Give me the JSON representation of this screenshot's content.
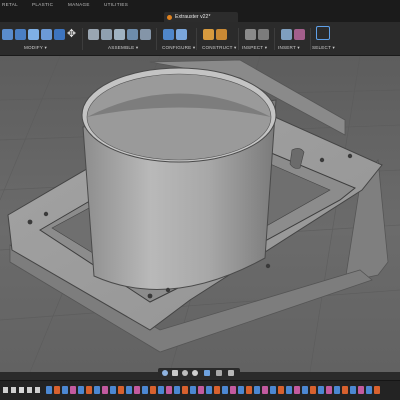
{
  "window": {
    "document_title": "Extrauster v22*"
  },
  "menu_tabs": [
    {
      "label": "RETAL"
    },
    {
      "label": "PLASTIC"
    },
    {
      "label": "MANAGE"
    },
    {
      "label": "UTILITIES"
    }
  ],
  "ribbon": {
    "groups": [
      {
        "label": "MODIFY ▾"
      },
      {
        "label": "ASSEMBLE ▾"
      },
      {
        "label": "CONFIGURE ▾"
      },
      {
        "label": "CONSTRUCT ▾"
      },
      {
        "label": "INSPECT ▾"
      },
      {
        "label": "INSERT ▾"
      },
      {
        "label": "SELECT ▾"
      }
    ]
  },
  "icons": {
    "file_indicator": "orange-dot-icon",
    "navigation": [
      "orbit-icon",
      "pan-icon",
      "zoom-icon",
      "fit-icon",
      "display-settings-icon",
      "grid-icon",
      "visual-style-icon"
    ],
    "timeline": [
      "go-to-start-icon",
      "step-back-icon",
      "play-icon",
      "step-forward-icon",
      "go-to-end-icon"
    ]
  },
  "colors": {
    "accent": "#5fa0e8",
    "file_indicator": "#e0821e",
    "background": "#2b2b2b",
    "viewport": "#656565",
    "part": "#8e8e8e"
  }
}
